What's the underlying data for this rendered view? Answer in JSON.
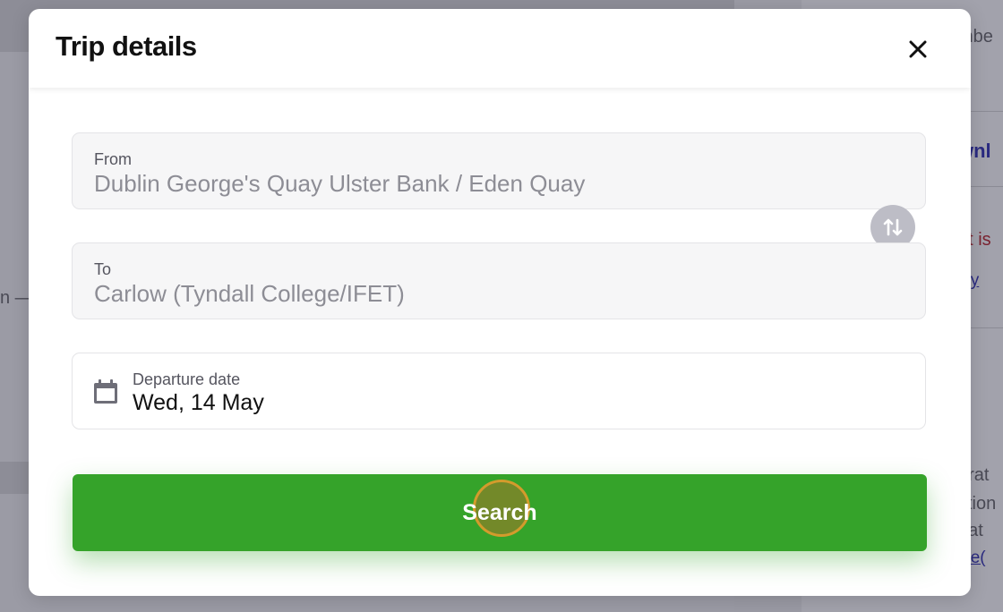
{
  "background": {
    "right_snippets": [
      "mbe",
      "wnl",
      "et is",
      "icy",
      "erat",
      "stion",
      "t at",
      "ice("
    ],
    "left_snippet": "n —"
  },
  "modal": {
    "title": "Trip details",
    "close_icon": "close-icon"
  },
  "from": {
    "label": "From",
    "value": "Dublin George's Quay Ulster Bank / Eden Quay"
  },
  "to": {
    "label": "To",
    "value": "Carlow (Tyndall College/IFET)"
  },
  "swap": {
    "icon": "swap-vertical-icon"
  },
  "departure": {
    "label": "Departure date",
    "value": "Wed, 14 May",
    "icon": "calendar-icon"
  },
  "search": {
    "label": "Search",
    "color": "#35a32a"
  }
}
